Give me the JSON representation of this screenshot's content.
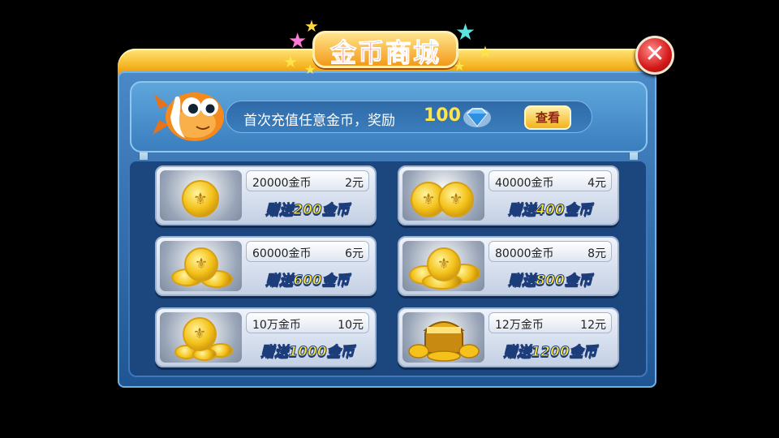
{
  "title": "金币商城",
  "close_icon": "close-icon",
  "banner": {
    "text": "首次充值任意金币，奖励",
    "reward_amount": "100",
    "reward_icon": "diamond-icon",
    "view_button": "查看"
  },
  "items": [
    {
      "amount": "20000金币",
      "price": "2元",
      "bonus": "赠送200金币"
    },
    {
      "amount": "40000金币",
      "price": "4元",
      "bonus": "赠送400金币"
    },
    {
      "amount": "60000金币",
      "price": "6元",
      "bonus": "赠送600金币"
    },
    {
      "amount": "80000金币",
      "price": "8元",
      "bonus": "赠送800金币"
    },
    {
      "amount": "10万金币",
      "price": "10元",
      "bonus": "赠送1000金币"
    },
    {
      "amount": "12万金币",
      "price": "12元",
      "bonus": "赠送1200金币"
    }
  ],
  "colors": {
    "accent": "#f6b521",
    "panel": "#1f5593",
    "bonus_text": "#ffe53a",
    "close": "#d41818"
  }
}
